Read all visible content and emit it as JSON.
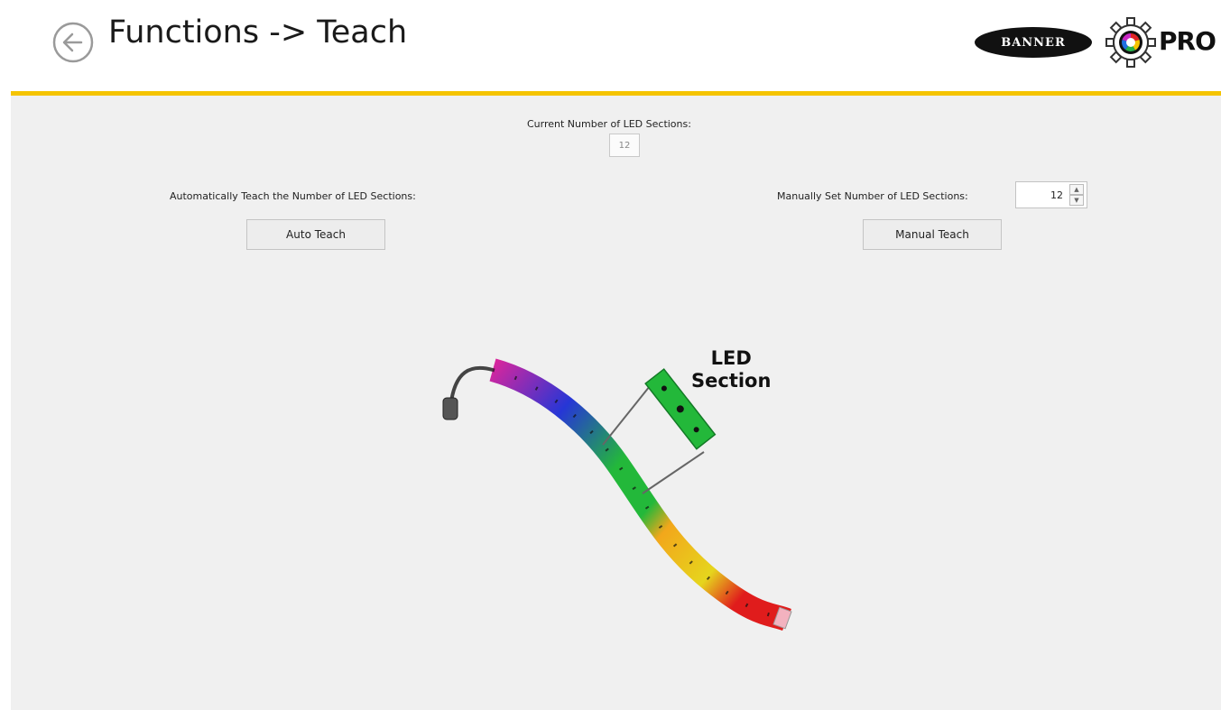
{
  "header": {
    "title": "Functions -> Teach",
    "brand_logo_text": "BANNER",
    "pro_logo_text": "PRO",
    "accent_color": "#f5c400"
  },
  "current_sections": {
    "label": "Current Number of LED Sections:",
    "value": "12"
  },
  "auto_teach": {
    "label": "Automatically Teach the Number of LED Sections:",
    "button_label": "Auto Teach"
  },
  "manual_teach": {
    "label": "Manually Set Number of LED Sections:",
    "value": "12",
    "button_label": "Manual Teach"
  },
  "diagram": {
    "callout_line1": "LED",
    "callout_line2": "Section",
    "section_colors": [
      "#e0259a",
      "#2636d6",
      "#23b83a",
      "#f2a71b",
      "#e01c1c"
    ]
  },
  "icons": {
    "back": "back-arrow-circle-icon",
    "spin_up": "chevron-up-icon",
    "spin_down": "chevron-down-icon",
    "gear": "gear-icon"
  }
}
